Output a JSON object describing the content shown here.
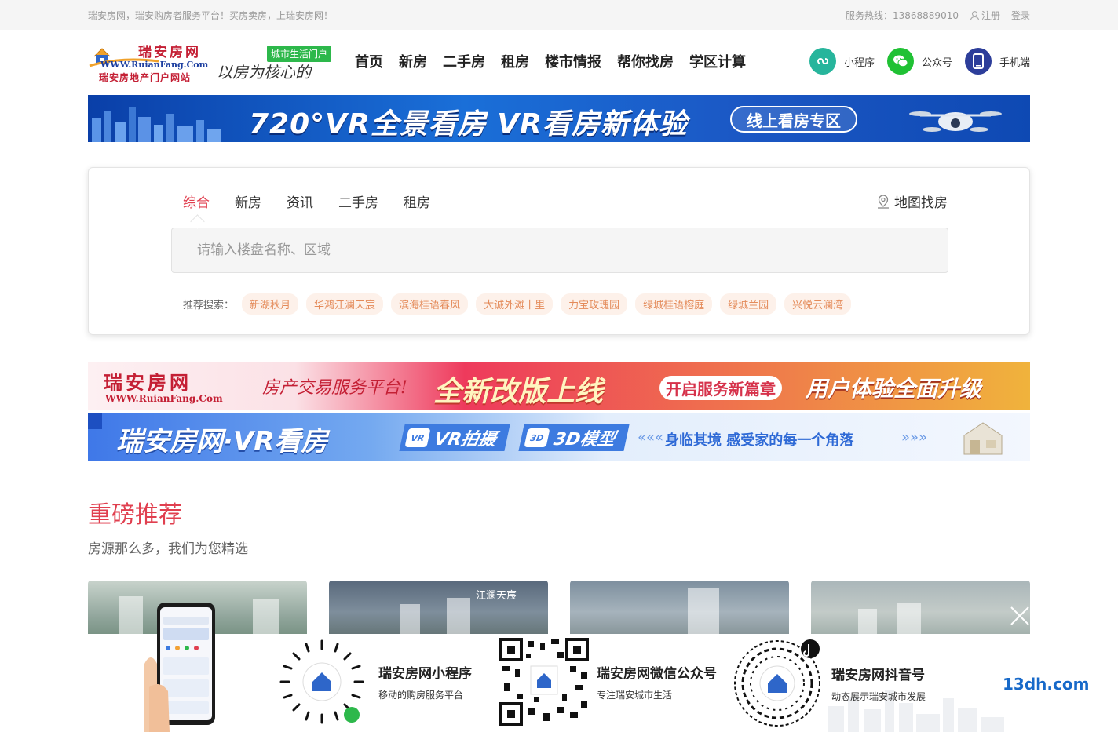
{
  "topbar": {
    "tagline": "瑞安房网，瑞安购房者服务平台！买房卖房，上瑞安房网！",
    "hotline": "服务热线：13868889010",
    "register": "注册",
    "login": "登录"
  },
  "header": {
    "logo_title": "瑞安房网",
    "logo_url": "WWW.RuianFang.Com",
    "logo_sub": "瑞安房地产门户网站",
    "slogan_tag": "城市生活门户",
    "slogan_text": "以房为核心的",
    "nav": [
      "首页",
      "新房",
      "二手房",
      "租房",
      "楼市情报",
      "帮你找房",
      "学区计算"
    ],
    "platforms": [
      {
        "label": "小程序",
        "icon": "mini-program-icon",
        "color": "#27b59c"
      },
      {
        "label": "公众号",
        "icon": "wechat-icon",
        "color": "#20c134"
      },
      {
        "label": "手机端",
        "icon": "mobile-icon",
        "color": "#2d3e9a"
      }
    ]
  },
  "banner_vr": {
    "title": "720°VR全景看房  VR看房新体验",
    "button": "线上看房专区"
  },
  "search": {
    "tabs": [
      "综合",
      "新房",
      "资讯",
      "二手房",
      "租房"
    ],
    "active_tab": "综合",
    "map_search": "地图找房",
    "placeholder": "请输入楼盘名称、区域",
    "hot_label": "推荐搜索：",
    "hot_tags": [
      "新湖秋月",
      "华鸿江澜天宸",
      "滨海桂语春风",
      "大诚外滩十里",
      "力宝玫瑰园",
      "绿城桂语榕庭",
      "绿城兰园",
      "兴悦云澜湾"
    ],
    "accent": "#e03f4f"
  },
  "banner_red": {
    "site": "瑞安房网",
    "site_url": "WWW.RuianFang.Com",
    "slogan": "房产交易服务平台!",
    "big": "全新改版上线",
    "pill": "开启服务新篇章",
    "big2": "用户体验全面升级"
  },
  "banner_blue": {
    "title": "瑞安房网·VR看房",
    "chip1_icon": "VR",
    "chip1": "VR拍摄",
    "chip2_icon": "3D",
    "chip2": "3D模型",
    "motto": "身临其境 感受家的每一个角落"
  },
  "recommend": {
    "title": "重磅推荐",
    "subtitle": "房源那么多，我们为您精选",
    "card2_label": "江澜天宸"
  },
  "floatbar": {
    "items": [
      {
        "title": "瑞安房网小程序",
        "desc": "移动的购房服务平台"
      },
      {
        "title": "瑞安房网微信公众号",
        "desc": "专注瑞安城市生活"
      },
      {
        "title": "瑞安房网抖音号",
        "desc": "动态展示瑞安城市发展"
      }
    ],
    "watermark": "13dh.com"
  }
}
